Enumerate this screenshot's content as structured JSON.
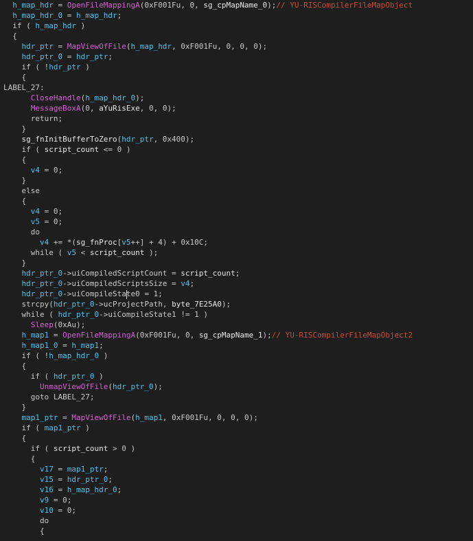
{
  "theme": {
    "background": "#1e1e1e",
    "text": "#c8c8c8",
    "local_variable": "#4fc1e9",
    "function": "#d45fd4",
    "global": "#e8e8e8",
    "comment": "#c44e3e"
  },
  "lines": [
    {
      "indent": 1,
      "tokens": [
        {
          "t": "h_map_hdr",
          "c": "lvar"
        },
        {
          "t": " = ",
          "c": "op"
        },
        {
          "t": "OpenFileMappingA",
          "c": "func"
        },
        {
          "t": "(0xF001Fu, 0, ",
          "c": "op"
        },
        {
          "t": "sg_cpMapName_0",
          "c": "glob"
        },
        {
          "t": ");",
          "c": "op"
        },
        {
          "t": "// YU-RISCompilerFileMapObject",
          "c": "cmt"
        }
      ]
    },
    {
      "indent": 1,
      "tokens": [
        {
          "t": "h_map_hdr_0",
          "c": "lvar"
        },
        {
          "t": " = ",
          "c": "op"
        },
        {
          "t": "h_map_hdr",
          "c": "lvar"
        },
        {
          "t": ";",
          "c": "op"
        }
      ]
    },
    {
      "indent": 1,
      "tokens": [
        {
          "t": "if ( ",
          "c": "kw"
        },
        {
          "t": "h_map_hdr",
          "c": "lvar"
        },
        {
          "t": " )",
          "c": "op"
        }
      ]
    },
    {
      "indent": 1,
      "tokens": [
        {
          "t": "{",
          "c": "op"
        }
      ]
    },
    {
      "indent": 2,
      "tokens": [
        {
          "t": "hdr_ptr",
          "c": "lvar"
        },
        {
          "t": " = ",
          "c": "op"
        },
        {
          "t": "MapViewOfFile",
          "c": "func"
        },
        {
          "t": "(",
          "c": "op"
        },
        {
          "t": "h_map_hdr",
          "c": "lvar"
        },
        {
          "t": ", 0xF001Fu, 0, 0, 0);",
          "c": "op"
        }
      ]
    },
    {
      "indent": 2,
      "tokens": [
        {
          "t": "hdr_ptr_0",
          "c": "lvar"
        },
        {
          "t": " = ",
          "c": "op"
        },
        {
          "t": "hdr_ptr",
          "c": "lvar"
        },
        {
          "t": ";",
          "c": "op"
        }
      ]
    },
    {
      "indent": 2,
      "tokens": [
        {
          "t": "if ( !",
          "c": "kw"
        },
        {
          "t": "hdr_ptr",
          "c": "lvar"
        },
        {
          "t": " )",
          "c": "op"
        }
      ]
    },
    {
      "indent": 2,
      "tokens": [
        {
          "t": "{",
          "c": "op"
        }
      ]
    },
    {
      "indent": 0,
      "tokens": [
        {
          "t": "LABEL_27:",
          "c": "label"
        }
      ]
    },
    {
      "indent": 3,
      "tokens": [
        {
          "t": "CloseHandle",
          "c": "func"
        },
        {
          "t": "(",
          "c": "op"
        },
        {
          "t": "h_map_hdr_0",
          "c": "lvar"
        },
        {
          "t": ");",
          "c": "op"
        }
      ]
    },
    {
      "indent": 3,
      "tokens": [
        {
          "t": "MessageBoxA",
          "c": "func"
        },
        {
          "t": "(0, ",
          "c": "op"
        },
        {
          "t": "aYuRisExe",
          "c": "glob"
        },
        {
          "t": ", 0, 0);",
          "c": "op"
        }
      ]
    },
    {
      "indent": 3,
      "tokens": [
        {
          "t": "return;",
          "c": "kw"
        }
      ]
    },
    {
      "indent": 2,
      "tokens": [
        {
          "t": "}",
          "c": "op"
        }
      ]
    },
    {
      "indent": 2,
      "tokens": [
        {
          "t": "sg_fnInitBufferToZero",
          "c": "glob"
        },
        {
          "t": "(",
          "c": "op"
        },
        {
          "t": "hdr_ptr",
          "c": "lvar"
        },
        {
          "t": ", 0x400);",
          "c": "op"
        }
      ]
    },
    {
      "indent": 2,
      "tokens": [
        {
          "t": "if ( ",
          "c": "kw"
        },
        {
          "t": "script_count",
          "c": "glob"
        },
        {
          "t": " <= 0 )",
          "c": "op"
        }
      ]
    },
    {
      "indent": 2,
      "tokens": [
        {
          "t": "{",
          "c": "op"
        }
      ]
    },
    {
      "indent": 3,
      "tokens": [
        {
          "t": "v4",
          "c": "lvar"
        },
        {
          "t": " = 0;",
          "c": "op"
        }
      ]
    },
    {
      "indent": 2,
      "tokens": [
        {
          "t": "}",
          "c": "op"
        }
      ]
    },
    {
      "indent": 2,
      "tokens": [
        {
          "t": "else",
          "c": "kw"
        }
      ]
    },
    {
      "indent": 2,
      "tokens": [
        {
          "t": "{",
          "c": "op"
        }
      ]
    },
    {
      "indent": 3,
      "tokens": [
        {
          "t": "v4",
          "c": "lvar"
        },
        {
          "t": " = 0;",
          "c": "op"
        }
      ]
    },
    {
      "indent": 3,
      "tokens": [
        {
          "t": "v5",
          "c": "lvar"
        },
        {
          "t": " = 0;",
          "c": "op"
        }
      ]
    },
    {
      "indent": 3,
      "tokens": [
        {
          "t": "do",
          "c": "kw"
        }
      ]
    },
    {
      "indent": 4,
      "tokens": [
        {
          "t": "v4",
          "c": "lvar"
        },
        {
          "t": " += *(",
          "c": "op"
        },
        {
          "t": "sg_fnProc",
          "c": "glob"
        },
        {
          "t": "[",
          "c": "op"
        },
        {
          "t": "v5",
          "c": "lvar"
        },
        {
          "t": "++] + 4) + 0x10C;",
          "c": "op"
        }
      ]
    },
    {
      "indent": 3,
      "tokens": [
        {
          "t": "while ( ",
          "c": "kw"
        },
        {
          "t": "v5",
          "c": "lvar"
        },
        {
          "t": " < ",
          "c": "op"
        },
        {
          "t": "script_count",
          "c": "glob"
        },
        {
          "t": " );",
          "c": "op"
        }
      ]
    },
    {
      "indent": 2,
      "tokens": [
        {
          "t": "}",
          "c": "op"
        }
      ]
    },
    {
      "indent": 2,
      "tokens": [
        {
          "t": "hdr_ptr_0",
          "c": "lvar"
        },
        {
          "t": "->uiCompiledScriptCount = ",
          "c": "op"
        },
        {
          "t": "script_count",
          "c": "glob"
        },
        {
          "t": ";",
          "c": "op"
        }
      ]
    },
    {
      "indent": 2,
      "tokens": [
        {
          "t": "hdr_ptr_0",
          "c": "lvar"
        },
        {
          "t": "->uiCompiledScriptsSize = ",
          "c": "op"
        },
        {
          "t": "v4",
          "c": "lvar"
        },
        {
          "t": ";",
          "c": "op"
        }
      ]
    },
    {
      "indent": 2,
      "tokens": [
        {
          "t": "hdr_ptr_0",
          "c": "lvar"
        },
        {
          "t": "->uiCompileState0 = 1;",
          "c": "op"
        }
      ]
    },
    {
      "indent": 2,
      "tokens": [
        {
          "t": "strcpy",
          "c": "kw"
        },
        {
          "t": "(",
          "c": "op"
        },
        {
          "t": "hdr_ptr_0",
          "c": "lvar"
        },
        {
          "t": "->ucProjectPath, ",
          "c": "op"
        },
        {
          "t": "byte_7E25A0",
          "c": "glob"
        },
        {
          "t": ");",
          "c": "op"
        }
      ]
    },
    {
      "indent": 2,
      "tokens": [
        {
          "t": "while ( ",
          "c": "kw"
        },
        {
          "t": "hdr_ptr_0",
          "c": "lvar"
        },
        {
          "t": "->uiCompileState1 != 1 )",
          "c": "op"
        }
      ]
    },
    {
      "indent": 3,
      "tokens": [
        {
          "t": "Sleep",
          "c": "func"
        },
        {
          "t": "(0xAu);",
          "c": "op"
        }
      ]
    },
    {
      "indent": 2,
      "tokens": [
        {
          "t": "h_map1",
          "c": "lvar"
        },
        {
          "t": " = ",
          "c": "op"
        },
        {
          "t": "OpenFileMappingA",
          "c": "func"
        },
        {
          "t": "(0xF001Fu, 0, ",
          "c": "op"
        },
        {
          "t": "sg_cpMapName_1",
          "c": "glob"
        },
        {
          "t": ");",
          "c": "op"
        },
        {
          "t": "// YU-RISCompilerFileMapObject2",
          "c": "cmt"
        }
      ]
    },
    {
      "indent": 2,
      "tokens": [
        {
          "t": "h_map1_0",
          "c": "lvar"
        },
        {
          "t": " = ",
          "c": "op"
        },
        {
          "t": "h_map1",
          "c": "lvar"
        },
        {
          "t": ";",
          "c": "op"
        }
      ]
    },
    {
      "indent": 2,
      "tokens": [
        {
          "t": "if ( !",
          "c": "kw"
        },
        {
          "t": "h_map_hdr_0",
          "c": "lvar"
        },
        {
          "t": " )",
          "c": "op"
        }
      ]
    },
    {
      "indent": 2,
      "tokens": [
        {
          "t": "{",
          "c": "op"
        }
      ]
    },
    {
      "indent": 3,
      "tokens": [
        {
          "t": "if ( ",
          "c": "kw"
        },
        {
          "t": "hdr_ptr_0",
          "c": "lvar"
        },
        {
          "t": " )",
          "c": "op"
        }
      ]
    },
    {
      "indent": 4,
      "tokens": [
        {
          "t": "UnmapViewOfFile",
          "c": "func"
        },
        {
          "t": "(",
          "c": "op"
        },
        {
          "t": "hdr_ptr_0",
          "c": "lvar"
        },
        {
          "t": ");",
          "c": "op"
        }
      ]
    },
    {
      "indent": 3,
      "tokens": [
        {
          "t": "goto LABEL_27;",
          "c": "kw"
        }
      ]
    },
    {
      "indent": 2,
      "tokens": [
        {
          "t": "}",
          "c": "op"
        }
      ]
    },
    {
      "indent": 2,
      "tokens": [
        {
          "t": "map1_ptr",
          "c": "lvar"
        },
        {
          "t": " = ",
          "c": "op"
        },
        {
          "t": "MapViewOfFile",
          "c": "func"
        },
        {
          "t": "(",
          "c": "op"
        },
        {
          "t": "h_map1",
          "c": "lvar"
        },
        {
          "t": ", 0xF001Fu, 0, 0, 0);",
          "c": "op"
        }
      ]
    },
    {
      "indent": 2,
      "tokens": [
        {
          "t": "if ( ",
          "c": "kw"
        },
        {
          "t": "map1_ptr",
          "c": "lvar"
        },
        {
          "t": " )",
          "c": "op"
        }
      ]
    },
    {
      "indent": 2,
      "tokens": [
        {
          "t": "{",
          "c": "op"
        }
      ]
    },
    {
      "indent": 3,
      "tokens": [
        {
          "t": "if ( ",
          "c": "kw"
        },
        {
          "t": "script_count",
          "c": "glob"
        },
        {
          "t": " > 0 )",
          "c": "op"
        }
      ]
    },
    {
      "indent": 3,
      "tokens": [
        {
          "t": "{",
          "c": "op"
        }
      ]
    },
    {
      "indent": 4,
      "tokens": [
        {
          "t": "v17",
          "c": "lvar"
        },
        {
          "t": " = ",
          "c": "op"
        },
        {
          "t": "map1_ptr",
          "c": "lvar"
        },
        {
          "t": ";",
          "c": "op"
        }
      ]
    },
    {
      "indent": 4,
      "tokens": [
        {
          "t": "v15",
          "c": "lvar"
        },
        {
          "t": " = ",
          "c": "op"
        },
        {
          "t": "hdr_ptr_0",
          "c": "lvar"
        },
        {
          "t": ";",
          "c": "op"
        }
      ]
    },
    {
      "indent": 4,
      "tokens": [
        {
          "t": "v16",
          "c": "lvar"
        },
        {
          "t": " = ",
          "c": "op"
        },
        {
          "t": "h_map_hdr_0",
          "c": "lvar"
        },
        {
          "t": ";",
          "c": "op"
        }
      ]
    },
    {
      "indent": 4,
      "tokens": [
        {
          "t": "v9",
          "c": "lvar"
        },
        {
          "t": " = 0;",
          "c": "op"
        }
      ]
    },
    {
      "indent": 4,
      "tokens": [
        {
          "t": "v10",
          "c": "lvar"
        },
        {
          "t": " = 0;",
          "c": "op"
        }
      ]
    },
    {
      "indent": 4,
      "tokens": [
        {
          "t": "do",
          "c": "kw"
        }
      ]
    },
    {
      "indent": 4,
      "tokens": [
        {
          "t": "{",
          "c": "op"
        }
      ]
    }
  ]
}
